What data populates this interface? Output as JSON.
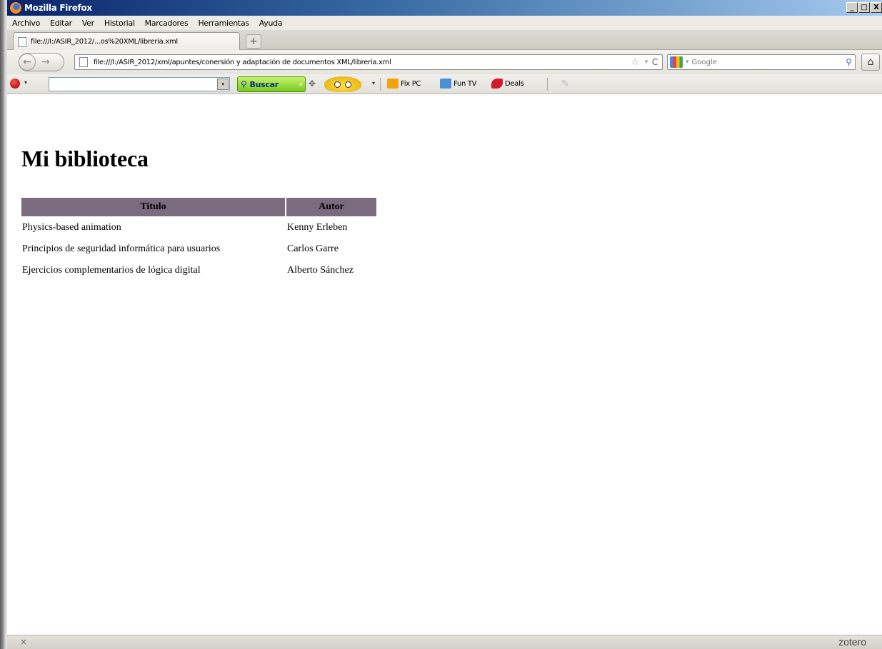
{
  "window": {
    "title": "Mozilla Firefox",
    "controls": {
      "minimize": "_",
      "maximize": "□",
      "close": "X"
    }
  },
  "menu": [
    "Archivo",
    "Editar",
    "Ver",
    "Historial",
    "Marcadores",
    "Herramientas",
    "Ayuda"
  ],
  "tab": {
    "title": "file:///I:/ASIR_2012/...os%20XML/libreria.xml",
    "new_tab_label": "+"
  },
  "nav": {
    "back": "←",
    "forward": "→",
    "url": "file:///I:/ASIR_2012/xml/apuntes/conersión y adaptación de documentos XML/libreria.xml",
    "star": "☆",
    "dropdown": "▾",
    "reload": "C",
    "search_placeholder": "Google",
    "search_icon": "⚲",
    "home": "⌂"
  },
  "toolbar": {
    "search_label": "Buscar",
    "links": [
      {
        "label": "Fix PC",
        "icon": "fix-pc-icon",
        "color": "#f2a20c"
      },
      {
        "label": "Fun TV",
        "icon": "tv-icon",
        "color": "#4a90d9"
      },
      {
        "label": "Deals",
        "icon": "deals-tag-icon",
        "color": "#d11a2a"
      }
    ]
  },
  "page": {
    "heading": "Mi biblioteca",
    "columns": [
      "Titulo",
      "Autor"
    ],
    "rows": [
      [
        "Physics-based animation",
        "Kenny Erleben"
      ],
      [
        "Principios de seguridad informática para usuarios",
        "Carlos Garre"
      ],
      [
        "Ejercicios complementarios de lógica digital",
        "Alberto Sánchez"
      ]
    ],
    "header_color": "#7a6b7f"
  },
  "status": {
    "close": "×",
    "zotero": "zotero"
  }
}
